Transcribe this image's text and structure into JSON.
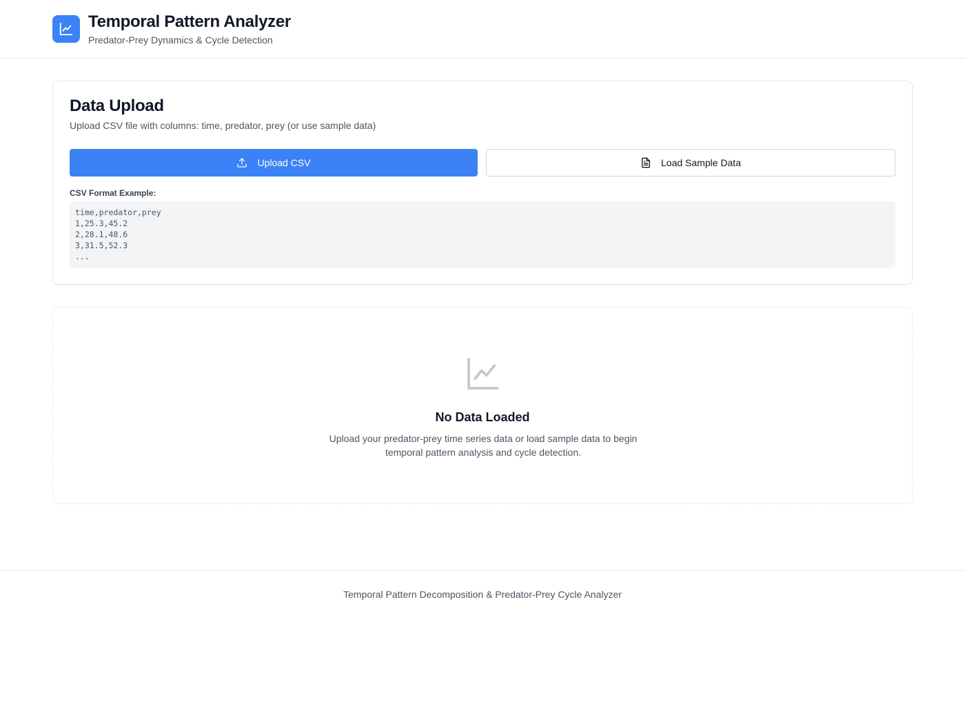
{
  "header": {
    "title": "Temporal Pattern Analyzer",
    "subtitle": "Predator-Prey Dynamics & Cycle Detection",
    "logo_icon": "chart-line-icon",
    "logo_color": "#3b82f6"
  },
  "upload": {
    "title": "Data Upload",
    "description": "Upload CSV file with columns: time, predator, prey (or use sample data)",
    "upload_button": {
      "label": "Upload CSV",
      "icon": "upload-icon"
    },
    "sample_button": {
      "label": "Load Sample Data",
      "icon": "file-text-icon"
    },
    "format_label": "CSV Format Example:",
    "format_lines": [
      "time,predator,prey",
      "1,25.3,45.2",
      "2,28.1,48.6",
      "3,31.5,52.3",
      "..."
    ]
  },
  "empty_state": {
    "icon": "chart-line-icon",
    "title": "No Data Loaded",
    "description": "Upload your predator-prey time series data or load sample data to begin temporal pattern analysis and cycle detection."
  },
  "footer": {
    "text": "Temporal Pattern Decomposition & Predator-Prey Cycle Analyzer"
  }
}
